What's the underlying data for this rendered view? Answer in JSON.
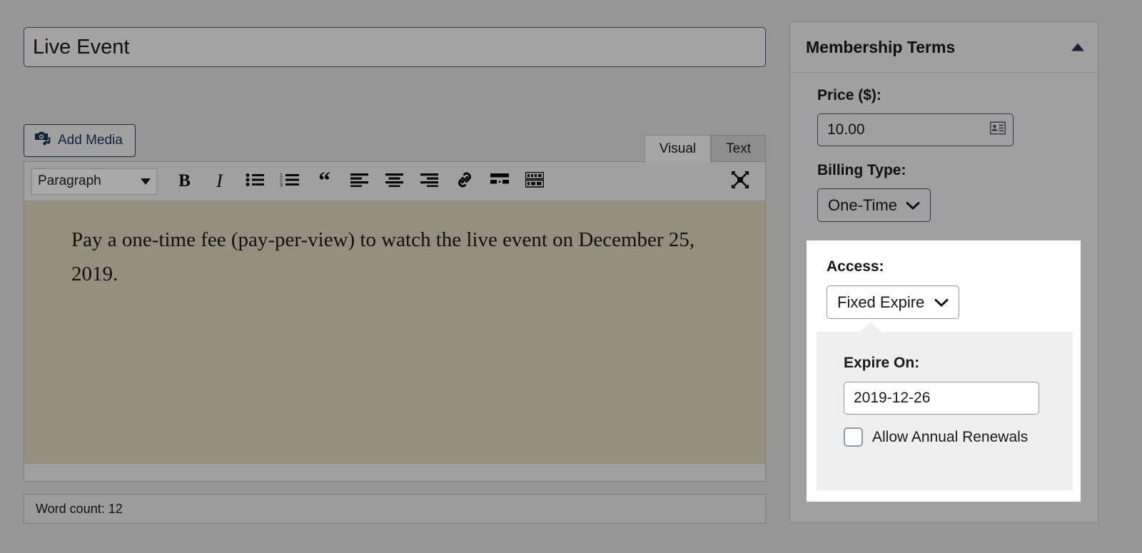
{
  "editor": {
    "title_value": "Live Event",
    "title_placeholder": "Enter title here",
    "add_media_label": "Add Media",
    "add_media_icon": "media-camera-note-icon",
    "tabs": [
      {
        "label": "Visual",
        "active": true
      },
      {
        "label": "Text",
        "active": false
      }
    ],
    "toolbar": {
      "format_select_value": "Paragraph",
      "buttons": [
        {
          "name": "bold-button",
          "glyph": "B"
        },
        {
          "name": "italic-button",
          "glyph": "I"
        },
        {
          "name": "bulleted-list-button",
          "glyph": "bulleted-list-icon"
        },
        {
          "name": "numbered-list-button",
          "glyph": "numbered-list-icon"
        },
        {
          "name": "blockquote-button",
          "glyph": "“"
        },
        {
          "name": "align-left-button",
          "glyph": "align-left-icon"
        },
        {
          "name": "align-center-button",
          "glyph": "align-center-icon"
        },
        {
          "name": "align-right-button",
          "glyph": "align-right-icon"
        },
        {
          "name": "insert-link-button",
          "glyph": "link-icon"
        },
        {
          "name": "read-more-button",
          "glyph": "read-more-icon"
        },
        {
          "name": "toolbar-toggle-button",
          "glyph": "keyboard-toolbar-icon"
        }
      ],
      "fullscreen_icon": "fullscreen-expand-icon"
    },
    "body_text": "Pay a one-time fee (pay-per-view) to watch the live event on December 25, 2019.",
    "word_count": "Word count: 12"
  },
  "meta_box": {
    "title": "Membership Terms",
    "toggle_icon": "chevron-up-icon",
    "price_label": "Price ($):",
    "price_value": "10.00",
    "price_autofill_icon": "contact-card-icon",
    "billing_type_label": "Billing Type:",
    "billing_type_value": "One-Time",
    "billing_type_caret": "chevron-down-icon"
  },
  "access_panel": {
    "access_label": "Access:",
    "access_value": "Fixed Expire",
    "access_caret": "chevron-down-icon",
    "expire_on_label": "Expire On:",
    "expire_on_value": "2019-12-26",
    "renewals_label": "Allow Annual Renewals",
    "renewals_checked": false
  },
  "colors": {
    "page_background": "#969696",
    "panel_background": "#a0a0a0",
    "editor_body_background": "#978f7d",
    "popup_white": "#ffffff",
    "popup_subpanel": "#efefef",
    "border_dark": "#2c3a4d",
    "accent_navy": "#11243f"
  }
}
